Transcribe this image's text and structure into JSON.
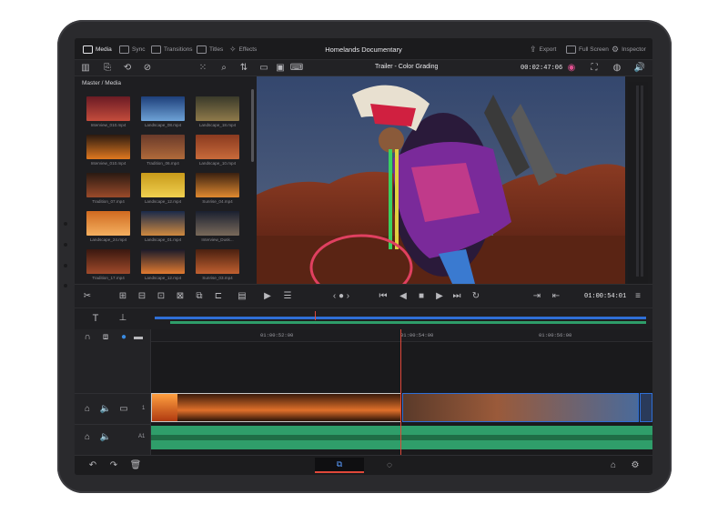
{
  "app": {
    "document_title": "Homelands Documentary",
    "timeline_name": "Trailer - Color Grading",
    "timeline_duration": "00:02:47:06",
    "viewer_timecode": "01:00:54:01"
  },
  "top_tabs": [
    {
      "label": "Media",
      "active": true
    },
    {
      "label": "Sync",
      "active": false
    },
    {
      "label": "Transitions",
      "active": false
    },
    {
      "label": "Titles",
      "active": false
    },
    {
      "label": "Effects",
      "active": false
    }
  ],
  "top_right": [
    {
      "label": "Export"
    },
    {
      "label": "Full Screen"
    },
    {
      "label": "Inspector"
    }
  ],
  "media_pool": {
    "title": "Master / Media",
    "clips": [
      {
        "label": "Interview_010.mp4",
        "c1": "#6b1b24",
        "c2": "#c44c3c"
      },
      {
        "label": "Landscape_08.mp4",
        "c1": "#1e3f7a",
        "c2": "#6ea2d6"
      },
      {
        "label": "Landscape_18.mp4",
        "c1": "#3a3a2a",
        "c2": "#8f7a4a"
      },
      {
        "label": "Interview_010.mp4",
        "c1": "#2b1a10",
        "c2": "#e0781f"
      },
      {
        "label": "Tradition_06.mp4",
        "c1": "#6a3a2a",
        "c2": "#b06a3a"
      },
      {
        "label": "Landscape_10.mp4",
        "c1": "#8a3a20",
        "c2": "#c86a3a"
      },
      {
        "label": "Tradition_07.mp4",
        "c1": "#2a1a12",
        "c2": "#9a4a2a"
      },
      {
        "label": "Landscape_12.mp4",
        "c1": "#c89a1a",
        "c2": "#f0d050"
      },
      {
        "label": "Sunrise_04.mp4",
        "c1": "#3a2010",
        "c2": "#e08a30"
      },
      {
        "label": "Landscape_24.mp4",
        "c1": "#d06a20",
        "c2": "#f4b060"
      },
      {
        "label": "Landscape_01.mp4",
        "c1": "#1a2a4a",
        "c2": "#d08a40"
      },
      {
        "label": "Interview_Dusk...",
        "c1": "#1a2030",
        "c2": "#7a6a5a"
      },
      {
        "label": "Tradition_17.mp4",
        "c1": "#3a1810",
        "c2": "#a04a2a"
      },
      {
        "label": "Landscape_12.mp4",
        "c1": "#1a1a2a",
        "c2": "#e07a30"
      },
      {
        "label": "Sunrise_03.mp4",
        "c1": "#4a2010",
        "c2": "#c06030"
      }
    ]
  },
  "timeline": {
    "ruler_marks": [
      "01:00:52:00",
      "01:00:54:00",
      "01:00:56:00"
    ],
    "video_track_number": "1",
    "audio_track_label": "A1"
  },
  "icons": {
    "media": "film-icon",
    "sync": "sync-icon",
    "transitions": "transitions-icon",
    "titles": "titles-icon",
    "effects": "sparkle-icon",
    "export": "export-icon",
    "fullscreen": "fullscreen-icon",
    "inspector": "sliders-icon"
  },
  "colors": {
    "accent": "#e0483a",
    "audio_track": "#2f9e6a",
    "video_clip_border": "#2f6fd6",
    "background": "#1c1c1e"
  }
}
